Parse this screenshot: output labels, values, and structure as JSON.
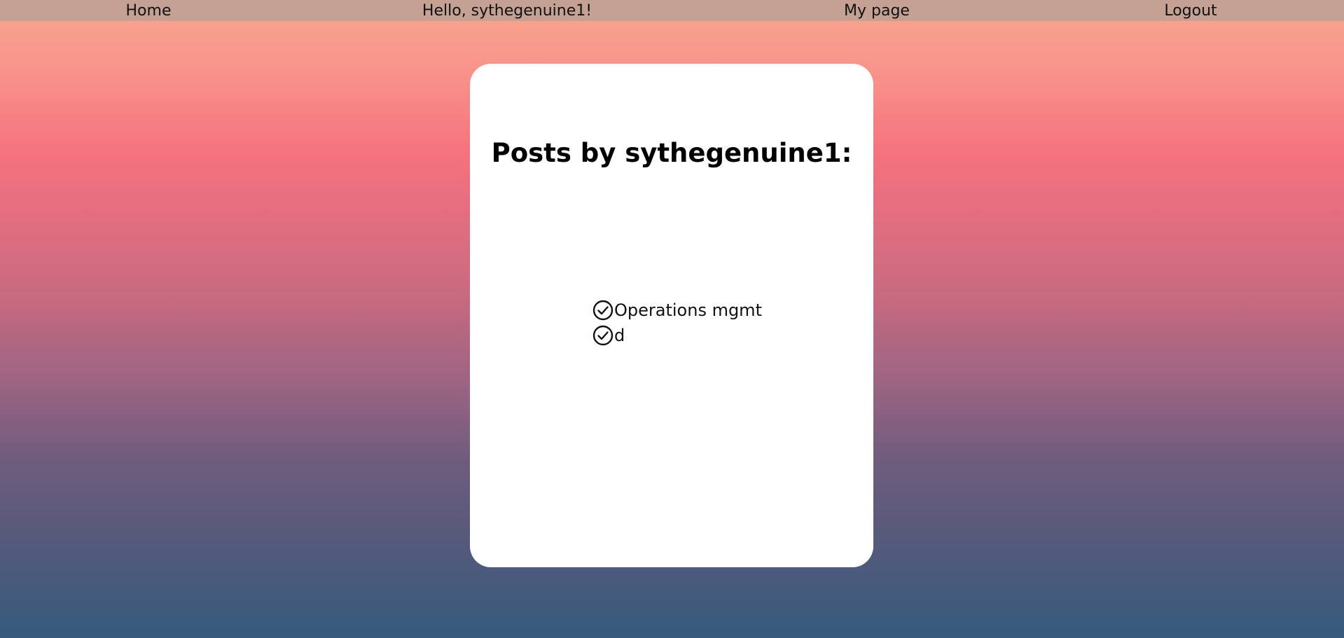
{
  "nav": {
    "home": "Home",
    "greeting": "Hello, sythegenuine1!",
    "my_page": "My page",
    "logout": "Logout"
  },
  "main": {
    "title": "Posts by sythegenuine1:",
    "posts": [
      {
        "label": "Operations mgmt",
        "icon": "check-circle-icon"
      },
      {
        "label": "d",
        "icon": "check-circle-icon"
      }
    ]
  },
  "colors": {
    "navbar_bg": "#c5a194",
    "card_bg": "#ffffff",
    "gradient_top": "#f9a890",
    "gradient_mid": "#f5727e",
    "gradient_bottom": "#355b7d"
  }
}
